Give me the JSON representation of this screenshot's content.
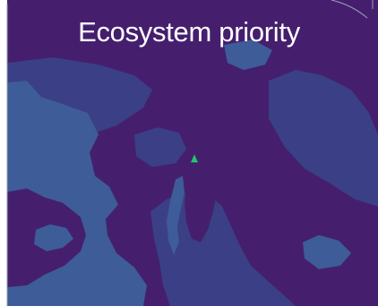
{
  "map": {
    "title": "Ecosystem priority",
    "colors": {
      "background": "#ffffff",
      "priority_high": "#451f6e",
      "priority_mid": "#3b3f86",
      "priority_low": "#3d5c98",
      "edge_lines": "#9aa0b4",
      "marker": "#23c56b",
      "title_text": "#ffffff"
    },
    "marker_icon": "green-triangle-marker"
  }
}
